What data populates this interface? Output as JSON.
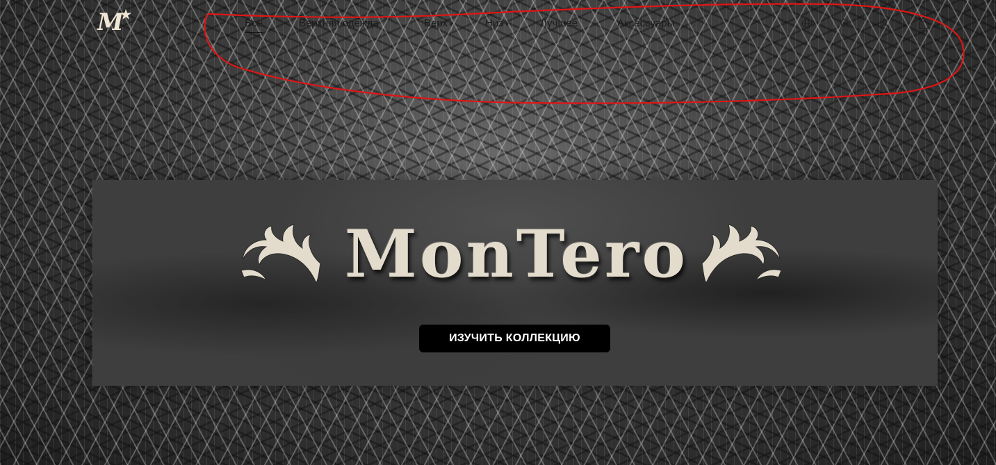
{
  "logo": {
    "text": "M",
    "star": "★",
    "icon": "montero-logo-icon"
  },
  "nav": {
    "items": [
      {
        "label": "Все",
        "dropdown": false,
        "active": true
      },
      {
        "label": "Верхняя одежда",
        "dropdown": false,
        "active": false
      },
      {
        "label": "Верх",
        "dropdown": true,
        "active": false
      },
      {
        "label": "Низ",
        "dropdown": true,
        "active": false
      },
      {
        "label": "Лучшее",
        "dropdown": false,
        "active": false
      },
      {
        "label": "Аксессуары",
        "dropdown": false,
        "active": false
      }
    ],
    "caret": "▾"
  },
  "header_icons": [
    "globe-icon",
    "search-icon",
    "user-icon",
    "cart-icon"
  ],
  "hero": {
    "brand": "MonTero",
    "cta_label": "ИЗУЧИТЬ КОЛЛЕКЦИЮ"
  },
  "colors": {
    "annotation": "#e01515",
    "brand_text": "#e3dccd",
    "cta_bg": "#000000",
    "cta_text": "#ffffff"
  }
}
